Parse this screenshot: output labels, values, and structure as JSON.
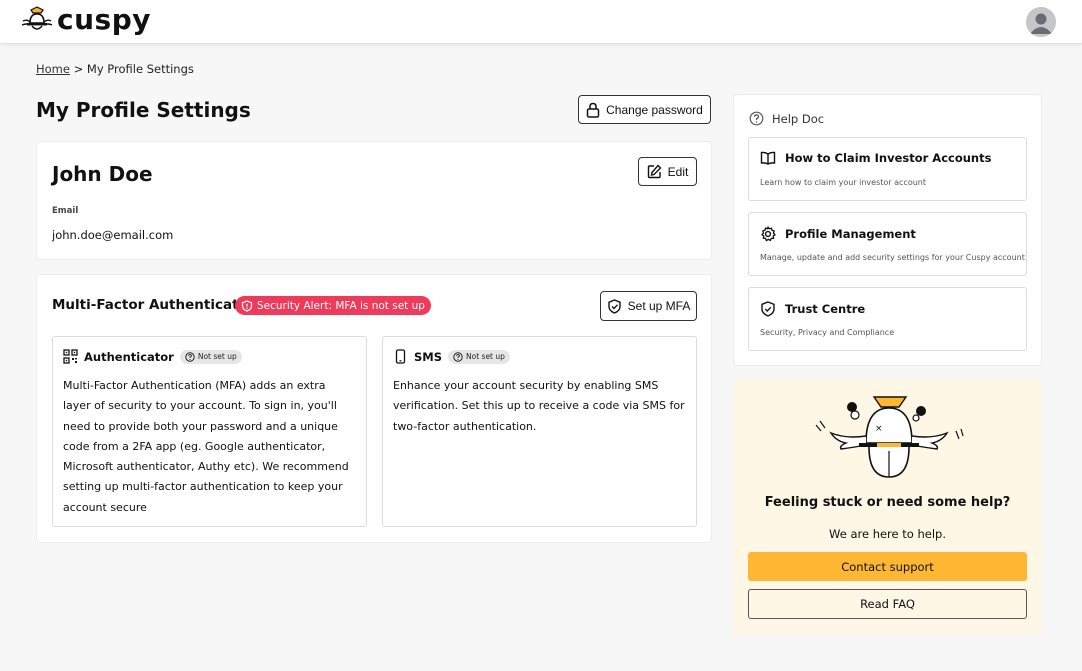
{
  "app": {
    "brand": "cuspy"
  },
  "breadcrumb": {
    "home": "Home",
    "separator": ">",
    "current": "My Profile Settings"
  },
  "page": {
    "title": "My Profile Settings",
    "change_password_label": "Change password"
  },
  "profile": {
    "name": "John Doe",
    "edit_label": "Edit",
    "email_label": "Email",
    "email_value": "john.doe@email.com"
  },
  "mfa": {
    "title": "Multi-Factor Authentication",
    "alert": "Security Alert: MFA is not set up",
    "setup_label": "Set up MFA",
    "authenticator": {
      "title": "Authenticator",
      "status": "Not set up",
      "description": "Multi-Factor Authentication (MFA) adds an extra layer of security to your account. To sign in, you'll need to provide both your password and a unique code from a 2FA app (eg. Google authenticator, Microsoft authenticator, Authy etc). We recommend setting up multi-factor authentication to keep your account secure"
    },
    "sms": {
      "title": "SMS",
      "status": "Not set up",
      "description": "Enhance your account security by enabling SMS verification. Set this up to receive a code via SMS for two-factor authentication."
    }
  },
  "help": {
    "title": "Help Doc",
    "items": [
      {
        "title": "How to Claim Investor Accounts",
        "description": "Learn how to claim your investor account",
        "icon": "book-icon"
      },
      {
        "title": "Profile Management",
        "description": "Manage, update and add security settings for your Cuspy account",
        "icon": "gear-icon"
      },
      {
        "title": "Trust Centre",
        "description": "Security, Privacy and Compliance",
        "icon": "shield-check-icon"
      }
    ]
  },
  "support": {
    "title": "Feeling stuck or need some help?",
    "subtitle": "We are here to help.",
    "contact_label": "Contact support",
    "faq_label": "Read FAQ"
  },
  "colors": {
    "alert": "#ef3b5b",
    "accent": "#fdb733",
    "support_bg": "#fff7e6"
  }
}
